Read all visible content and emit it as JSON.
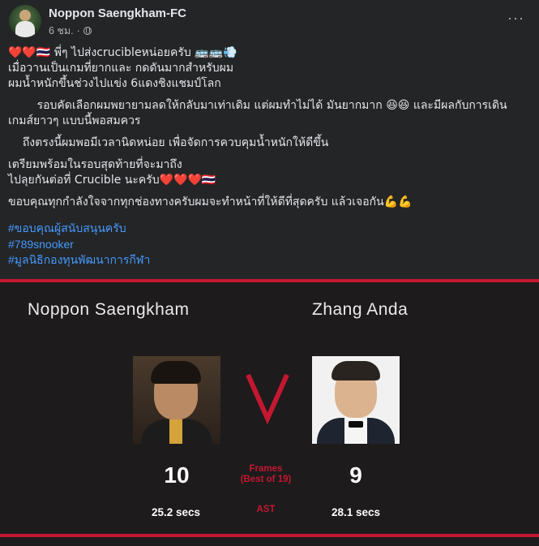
{
  "post": {
    "author": "Noppon Saengkham-FC",
    "time": "6 ชม.",
    "more_label": "···",
    "lines": [
      "❤️❤️🇹🇭 พี่ๆ ไปส่งcrucibleหน่อยครับ 🚌🚌💨",
      "เมื่อวานเป็นเกมที่ยากและ กดดันมากสำหรับผม",
      "ผมน้ำหนักขึ้นช่วงไปแข่ง 6แดงชิงแชมป์โลก",
      "",
      "        รอบคัดเลือกผมพยายามลดให้กลับมาเท่าเดิม แต่ผมทำไม่ได้ มันยากมาก 😆😆 และมีผลกับการเดิน",
      "เกมส์ยาวๆ แบบนี้พอสมควร ",
      "",
      "    ถึงตรงนี้ผมพอมีเวลานิดหน่อย เพื่อจัดการควบคุมน้ำหนักให้ดีขึ้น",
      "",
      "เตรียมพร้อมในรอบสุดท้ายที่จะมาถึง",
      "ไปลุยกันต่อที่ Crucible นะครับ❤️❤️❤️🇹🇭",
      "",
      "ขอบคุณทุกกำลังใจจากทุกช่องทางครับผมจะทำหน้าที่ให้ดีที่สุดครับ แล้วเจอกัน💪💪"
    ],
    "hashtags": [
      "#ขอบคุณผู้สนับสนุนครับ",
      "#789snooker",
      "#มูลนิธิกองทุนพัฒนาการกีฬา"
    ]
  },
  "match": {
    "player1": "Noppon Saengkham",
    "player2": "Zhang Anda",
    "vs": "V",
    "score1": "10",
    "score2": "9",
    "frames_label": "Frames",
    "best_of": "(Best of 19)",
    "ast_label": "AST",
    "ast1": "25.2 secs",
    "ast2": "28.1 secs"
  },
  "colors": {
    "accent_red": "#c41730",
    "hashtag_blue": "#4599ff",
    "background": "#242526",
    "card_background": "#1d1b1c"
  }
}
